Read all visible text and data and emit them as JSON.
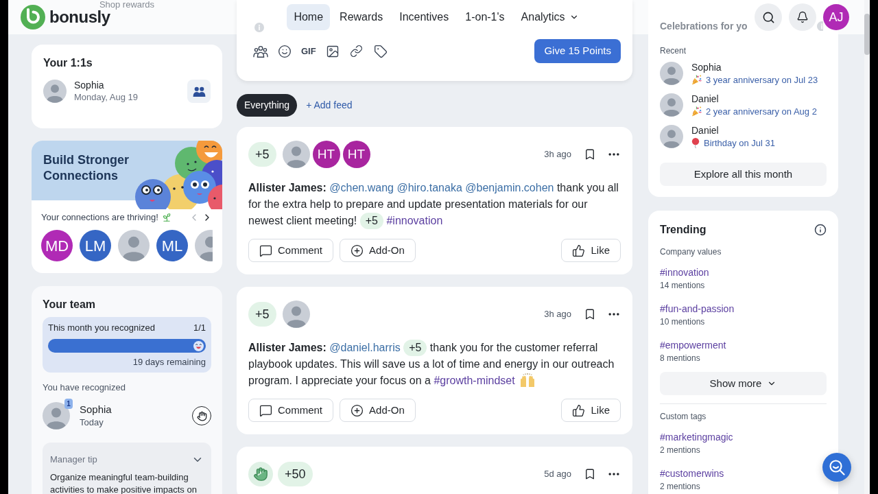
{
  "header": {
    "logo": "bonusly",
    "nav": [
      {
        "label": "Home",
        "selected": true,
        "has_menu": false
      },
      {
        "label": "Rewards",
        "selected": false,
        "has_menu": false
      },
      {
        "label": "Incentives",
        "selected": false,
        "has_menu": false
      },
      {
        "label": "1-on-1's",
        "selected": false,
        "has_menu": false
      },
      {
        "label": "Analytics",
        "selected": false,
        "has_menu": true
      }
    ],
    "user_initials": "AJ"
  },
  "left": {
    "shop_rewards": "Shop rewards",
    "one_on_ones": {
      "title": "Your 1:1s",
      "meetings": [
        {
          "name": "Sophia",
          "date": "Monday, Aug 19"
        }
      ]
    },
    "connections": {
      "title": "Build Stronger Connections",
      "subtitle": "Your connections are thriving!",
      "people": [
        {
          "kind": "initials",
          "initials": "MD",
          "color": "#b02ab5"
        },
        {
          "kind": "initials",
          "initials": "LM",
          "color": "#3566c4"
        },
        {
          "kind": "photo"
        },
        {
          "kind": "initials",
          "initials": "ML",
          "color": "#3566c4"
        },
        {
          "kind": "photo"
        }
      ]
    },
    "team": {
      "title": "Your team",
      "progress": {
        "label": "This month you recognized",
        "count": "1/1",
        "level": 1,
        "remaining": "19 days remaining"
      },
      "recognized_label": "You have recognized",
      "recognized": [
        {
          "name": "Sophia",
          "when": "Today",
          "count": "1"
        }
      ],
      "tip": {
        "title": "Manager tip",
        "text": "Organize meaningful team-building activities to make positive impacts on"
      }
    }
  },
  "feed": {
    "composer": {
      "gif": "GIF",
      "give_button": "Give 15 Points"
    },
    "filters": [
      {
        "label": "Everything",
        "selected": true
      }
    ],
    "add_feed": "+ Add feed",
    "posts": [
      {
        "header": [
          {
            "kind": "points",
            "text": "+5"
          },
          {
            "kind": "photo"
          },
          {
            "kind": "initials",
            "text": "HT"
          },
          {
            "kind": "initials",
            "text": "HT"
          }
        ],
        "time": "3h ago",
        "body": [
          {
            "kind": "author",
            "text": "Allister James:"
          },
          {
            "kind": "mention",
            "text": "@chen.wang"
          },
          {
            "kind": "mention",
            "text": "@hiro.tanaka"
          },
          {
            "kind": "mention",
            "text": "@benjamin.cohen"
          },
          {
            "kind": "text",
            "text": "thank you all for the extra help to prepare and update presentation materials for our newest client meeting!"
          },
          {
            "kind": "points",
            "text": "+5"
          },
          {
            "kind": "tag",
            "text": "#innovation"
          }
        ],
        "actions": {
          "comment": "Comment",
          "addon": "Add-On",
          "like": "Like"
        }
      },
      {
        "header": [
          {
            "kind": "points",
            "text": "+5"
          },
          {
            "kind": "photo"
          }
        ],
        "time": "3h ago",
        "body": [
          {
            "kind": "author",
            "text": "Allister James:"
          },
          {
            "kind": "mention",
            "text": "@daniel.harris"
          },
          {
            "kind": "points",
            "text": "+5"
          },
          {
            "kind": "text",
            "text": "thank you for the customer referral playbook updates. This will save us a lot of time and energy in our outreach program. I appreciate your focus on a"
          },
          {
            "kind": "tag",
            "text": "#growth-mindset"
          },
          {
            "kind": "raised_hands"
          }
        ],
        "actions": {
          "comment": "Comment",
          "addon": "Add-On",
          "like": "Like"
        }
      },
      {
        "header": [
          {
            "kind": "wave"
          },
          {
            "kind": "points",
            "text": "+50"
          }
        ],
        "time": "5d ago"
      }
    ]
  },
  "right": {
    "celebrations": {
      "title": "Celebrations for yo",
      "section": "Recent",
      "items": [
        {
          "name": "Sophia",
          "kind": "anniversary",
          "text": "3 year anniversary on Jul 23"
        },
        {
          "name": "Daniel",
          "kind": "anniversary",
          "text": "2 year anniversary on Aug 2"
        },
        {
          "name": "Daniel",
          "kind": "birthday",
          "text": "Birthday on Jul 31"
        }
      ],
      "button": "Explore all this month"
    },
    "trending": {
      "title": "Trending",
      "groups": [
        {
          "label": "Company values",
          "tags": [
            {
              "tag": "#innovation",
              "count": "14 mentions"
            },
            {
              "tag": "#fun-and-passion",
              "count": "10 mentions"
            },
            {
              "tag": "#empowerment",
              "count": "8 mentions"
            }
          ],
          "more": "Show more"
        },
        {
          "label": "Custom tags",
          "tags": [
            {
              "tag": "#marketingmagic",
              "count": "2 mentions"
            },
            {
              "tag": "#customerwins",
              "count": "2 mentions"
            }
          ]
        }
      ]
    }
  }
}
